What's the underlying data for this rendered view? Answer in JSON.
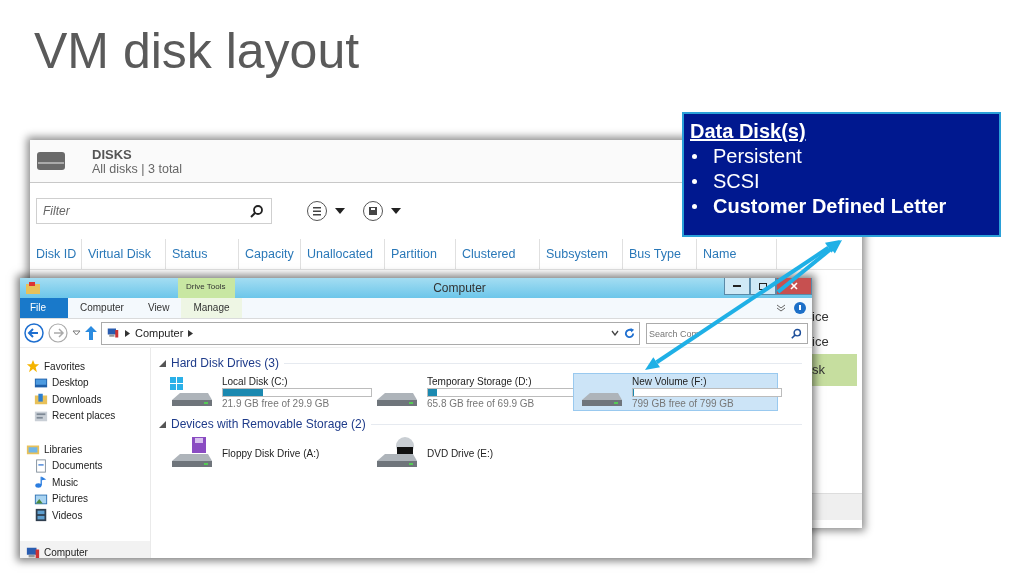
{
  "slide": {
    "title": "VM disk layout"
  },
  "disks_panel": {
    "title": "DISKS",
    "subtitle": "All disks | 3 total",
    "filter": {
      "placeholder": "Filter"
    },
    "columns": [
      "Disk ID",
      "Virtual Disk",
      "Status",
      "Capacity",
      "Unallocated",
      "Partition",
      "Clustered",
      "Subsystem",
      "Bus Type",
      "Name"
    ],
    "rows": [
      {
        "name": "ice",
        "selected": false
      },
      {
        "name": "ice",
        "selected": false
      },
      {
        "name": "sk",
        "selected": true
      }
    ]
  },
  "explorer": {
    "title": "Computer",
    "context_tab": "Drive Tools",
    "ribbon_tabs": [
      {
        "label": "File",
        "kind": "file"
      },
      {
        "label": "Computer",
        "kind": "tab"
      },
      {
        "label": "View",
        "kind": "tab"
      },
      {
        "label": "Manage",
        "kind": "context"
      }
    ],
    "address": [
      "Computer"
    ],
    "search": {
      "placeholder": "Search Com"
    },
    "sidebar": [
      {
        "label": "Favorites",
        "kind": "favorites",
        "children": [
          {
            "label": "Desktop",
            "kind": "desktop"
          },
          {
            "label": "Downloads",
            "kind": "downloads"
          },
          {
            "label": "Recent places",
            "kind": "recent"
          }
        ]
      },
      {
        "label": "Libraries",
        "kind": "libraries",
        "children": [
          {
            "label": "Documents",
            "kind": "documents"
          },
          {
            "label": "Music",
            "kind": "music"
          },
          {
            "label": "Pictures",
            "kind": "pictures"
          },
          {
            "label": "Videos",
            "kind": "videos"
          }
        ]
      },
      {
        "label": "Computer",
        "kind": "computer"
      }
    ],
    "sections": [
      {
        "title": "Hard Disk Drives (3)",
        "expanded": true,
        "items": [
          {
            "name": "Local Disk (C:)",
            "kind": "system",
            "level": 0.27,
            "free": "21.9 GB free of 29.9 GB",
            "selected": false
          },
          {
            "name": "Temporary Storage (D:)",
            "kind": "disk",
            "level": 0.06,
            "free": "65.8 GB free of 69.9 GB",
            "selected": false
          },
          {
            "name": "New Volume (F:)",
            "kind": "disk",
            "level": 0,
            "free": "799 GB free of 799 GB",
            "selected": true
          }
        ]
      },
      {
        "title": "Devices with Removable Storage (2)",
        "expanded": true,
        "items": [
          {
            "name": "Floppy Disk Drive (A:)",
            "kind": "floppy",
            "selected": false
          },
          {
            "name": "DVD Drive (E:)",
            "kind": "dvd",
            "selected": false
          }
        ]
      }
    ]
  },
  "callout": {
    "heading": "Data Disk(s)",
    "items": [
      {
        "text": "Persistent",
        "bold": false
      },
      {
        "text": "SCSI",
        "bold": false
      },
      {
        "text": "Customer Defined Letter",
        "bold": true
      }
    ]
  }
}
